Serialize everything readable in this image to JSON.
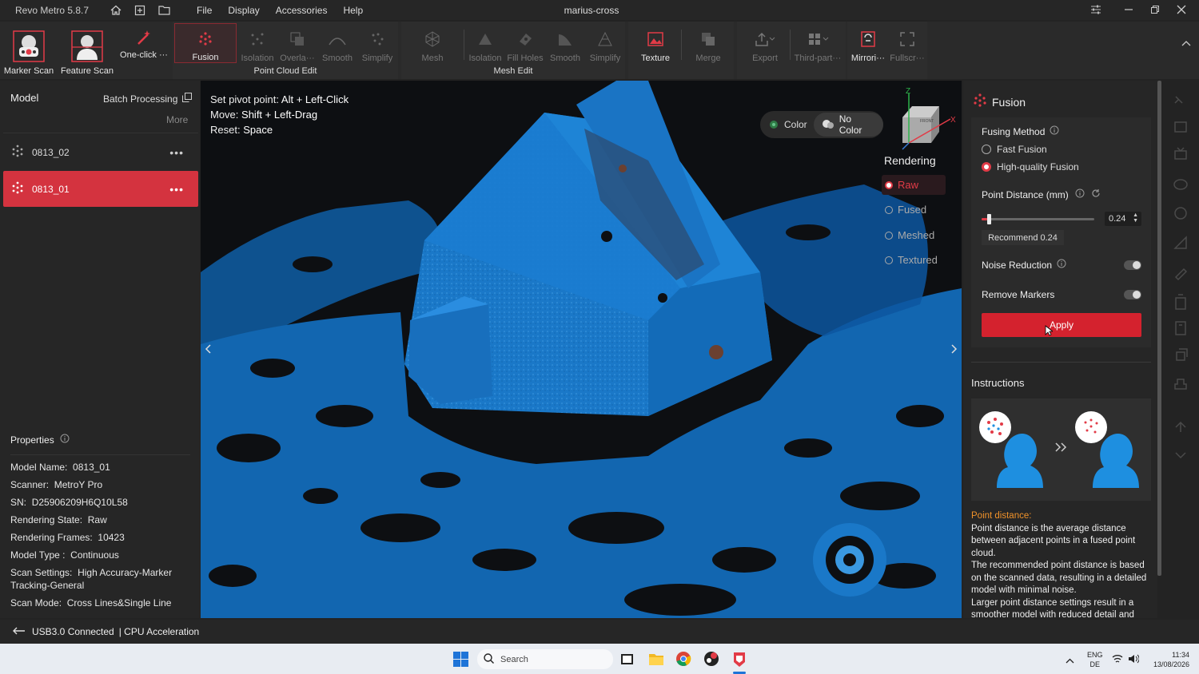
{
  "app": {
    "name": "Revo Metro 5.8.7",
    "window_title": "marius-cross",
    "menu": [
      "File",
      "Display",
      "Accessories",
      "Help"
    ]
  },
  "toolbar": {
    "marker_scan": "Marker Scan",
    "feature_scan": "Feature Scan",
    "one_click": "One-click ···",
    "pc": {
      "fusion": "Fusion",
      "isolation": "Isolation",
      "overlap": "Overla···",
      "smooth": "Smooth",
      "simplify": "Simplify",
      "group": "Point Cloud Edit"
    },
    "me": {
      "mesh": "Mesh",
      "isolation": "Isolation",
      "fill_holes": "Fill Holes",
      "smooth": "Smooth",
      "simplify": "Simplify",
      "group": "Mesh Edit"
    },
    "texture": "Texture",
    "merge": "Merge",
    "export": "Export",
    "third_party": "Third-part···",
    "mirror": "Mirrori···",
    "fullscreen": "Fullscr···",
    "accent": "#e23b47"
  },
  "left": {
    "model_label": "Model",
    "batch": "Batch Processing",
    "more": "More",
    "models": [
      {
        "name": "0813_02",
        "selected": false
      },
      {
        "name": "0813_01",
        "selected": true
      }
    ],
    "properties_label": "Properties",
    "props": [
      {
        "k": "Model Name:",
        "v": "0813_01"
      },
      {
        "k": "Scanner:",
        "v": "MetroY Pro"
      },
      {
        "k": "SN:",
        "v": "D25906209H6Q10L58"
      },
      {
        "k": "Rendering State:",
        "v": "Raw"
      },
      {
        "k": "Rendering Frames:",
        "v": "10423"
      },
      {
        "k": "Model Type :",
        "v": "Continuous"
      },
      {
        "k": "Scan Settings:",
        "v": "High Accuracy-Marker Tracking-General"
      },
      {
        "k": "Scan Mode:",
        "v": "Cross Lines&Single Line"
      }
    ]
  },
  "viewport": {
    "hints": [
      {
        "k": "Set pivot point:",
        "v": "Alt + Left-Click"
      },
      {
        "k": "Move:",
        "v": "Shift + Left-Drag"
      },
      {
        "k": "Reset:",
        "v": "Space"
      }
    ],
    "color": "Color",
    "no_color": "No Color",
    "rendering_label": "Rendering",
    "modes": [
      {
        "label": "Raw",
        "selected": true
      },
      {
        "label": "Fused",
        "selected": false
      },
      {
        "label": "Meshed",
        "selected": false
      },
      {
        "label": "Textured",
        "selected": false
      }
    ],
    "cube": {
      "z": "Z",
      "x": "X",
      "face": "FRONT"
    },
    "model_color": "#1a78c8"
  },
  "fusion": {
    "title": "Fusion",
    "method_label": "Fusing Method",
    "fast": "Fast Fusion",
    "hq": "High-quality Fusion",
    "pd_label": "Point Distance (mm)",
    "pd_value": "0.24",
    "pd_slider_fraction": 0.05,
    "recommend": "Recommend 0.24",
    "noise": "Noise Reduction",
    "markers": "Remove Markers",
    "apply": "Apply",
    "instructions": "Instructions",
    "pd_heading": "Point distance:",
    "pd_text1": "Point distance is the average distance between adjacent points in a fused point cloud.",
    "pd_text2": "The recommended point distance is based on the scanned data, resulting in a detailed model with minimal noise.",
    "pd_text3": "Larger point distance settings result in a smoother model with reduced detail and"
  },
  "status": {
    "usb": "USB3.0 Connected",
    "cpu": "| CPU Acceleration"
  },
  "taskbar": {
    "search": "Search",
    "lang1": "ENG",
    "lang2": "DE",
    "time": "11:34",
    "date": "13/08/2026"
  }
}
